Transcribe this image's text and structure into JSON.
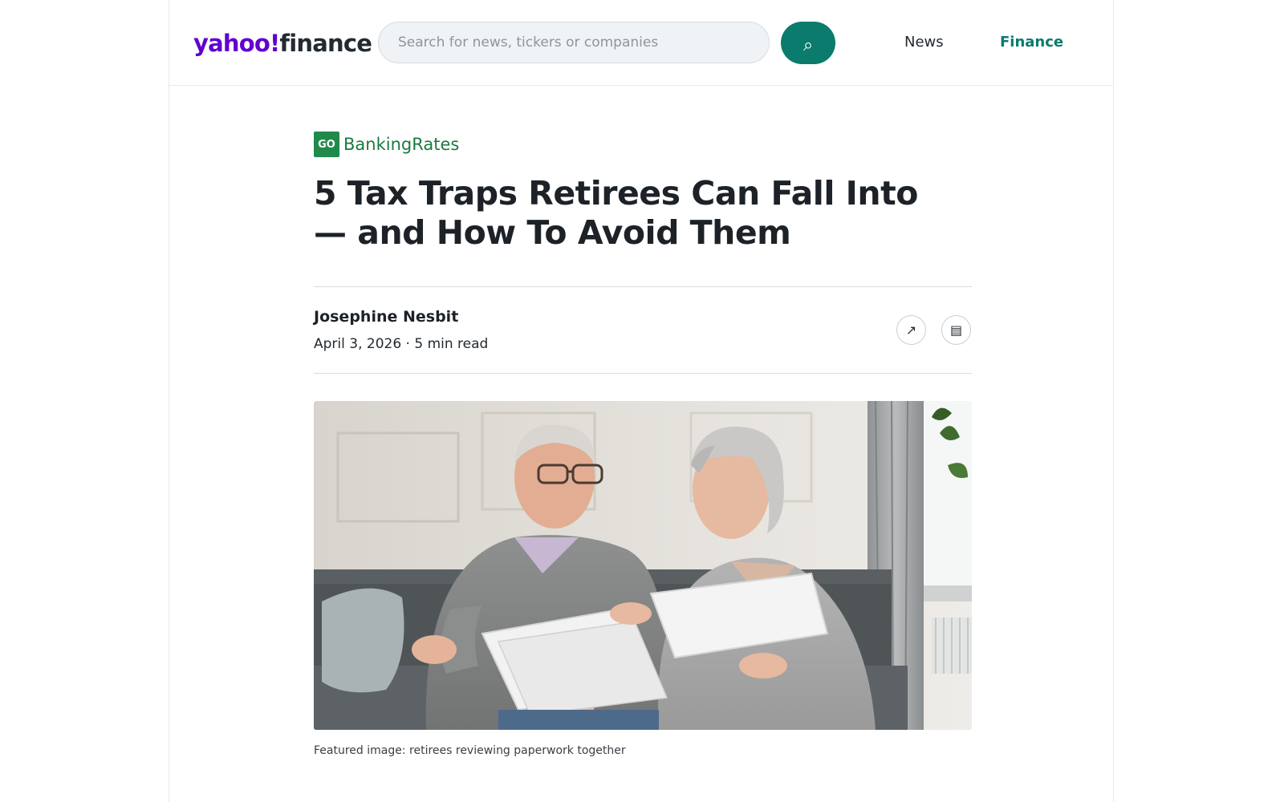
{
  "header": {
    "logo_part1": "yahoo!",
    "logo_part2": "finance",
    "search_placeholder": "Search for news, tickers or companies",
    "search_value": "",
    "search_button_icon": "⌕",
    "nav": {
      "news": "News",
      "finance": "Finance"
    }
  },
  "article": {
    "provider": {
      "logo_text": "GO",
      "name": "BankingRates"
    },
    "headline": "5 Tax Traps Retirees Can Fall Into — and How To Avoid Them",
    "author": "Josephine Nesbit",
    "meta": "April 3, 2026 · 5 min read",
    "share_icon": "↗",
    "comments_icon": "▤",
    "image_caption": "Featured image: retirees reviewing paperwork together"
  },
  "colors": {
    "yahoo_purple": "#6001d2",
    "finance_green": "#0a7b6c",
    "provider_green": "#1f8a4c"
  }
}
